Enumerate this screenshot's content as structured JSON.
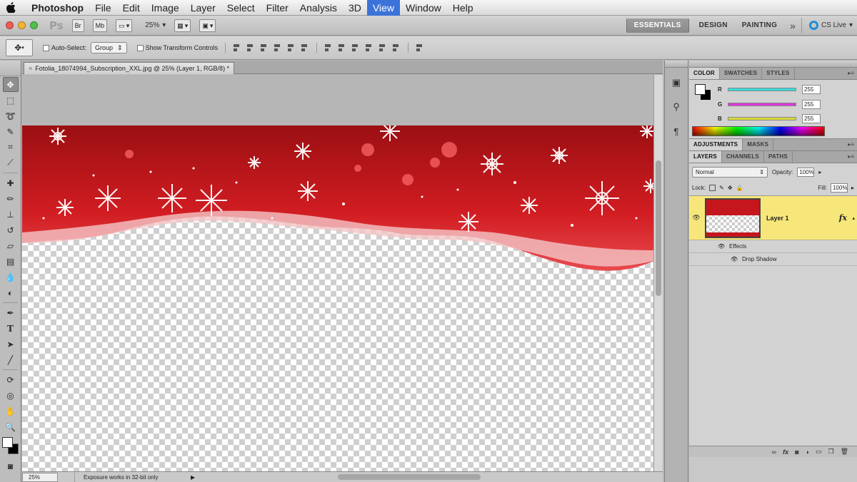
{
  "menubar": {
    "app_name": "Photoshop",
    "items": [
      "File",
      "Edit",
      "Image",
      "Layer",
      "Select",
      "Filter",
      "Analysis",
      "3D",
      "View",
      "Window",
      "Help"
    ],
    "active_item": "View"
  },
  "appbar": {
    "logo": "Ps",
    "zoom": "25%",
    "workspaces": [
      "ESSENTIALS",
      "DESIGN",
      "PAINTING"
    ],
    "more": "»",
    "cs_live": "CS Live"
  },
  "options": {
    "auto_select_label": "Auto-Select:",
    "auto_select_value": "Group",
    "transform_label": "Show Transform Controls"
  },
  "document": {
    "tab_title": "Fotolia_18074994_Subscription_XXL.jpg @ 25% (Layer 1, RGB/8) *",
    "status_zoom": "25%",
    "status_message": "Exposure works in 32-bit only"
  },
  "color_panel": {
    "tabs": [
      "COLOR",
      "SWATCHES",
      "STYLES"
    ],
    "sliders": [
      {
        "label": "R",
        "value": "255",
        "color": "#39d9d9"
      },
      {
        "label": "G",
        "value": "255",
        "color": "#d939d9"
      },
      {
        "label": "B",
        "value": "255",
        "color": "#d9d939"
      }
    ]
  },
  "adjust_panel": {
    "tabs": [
      "ADJUSTMENTS",
      "MASKS"
    ]
  },
  "layers_panel": {
    "tabs": [
      "LAYERS",
      "CHANNELS",
      "PATHS"
    ],
    "blend_mode": "Normal",
    "opacity_label": "Opacity:",
    "opacity": "100%",
    "lock_label": "Lock:",
    "fill_label": "Fill:",
    "fill": "100%",
    "layer_name": "Layer 1",
    "fx": "fx",
    "effects_label": "Effects",
    "effect_item": "Drop Shadow"
  },
  "colors": {
    "accent_menu": "#3b73d9",
    "layer_highlight": "#f7e77a",
    "banner_red": "#c4161c"
  }
}
